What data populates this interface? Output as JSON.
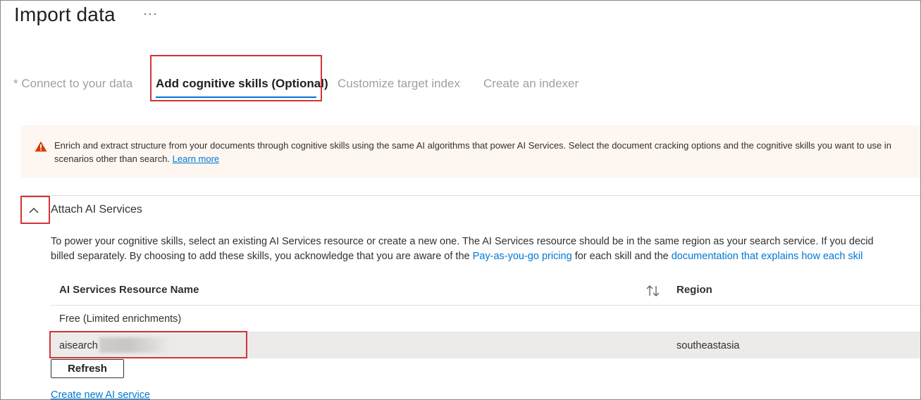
{
  "page": {
    "title": "Import data",
    "more_label": "···"
  },
  "wizard": {
    "tabs": [
      {
        "label": "* Connect to your data",
        "state": "inactive"
      },
      {
        "label": "Add cognitive skills (Optional)",
        "state": "active"
      },
      {
        "label": "Customize target index",
        "state": "inactive"
      },
      {
        "label": "Create an indexer",
        "state": "inactive"
      }
    ]
  },
  "banner": {
    "icon": "warning-icon",
    "text": "Enrich and extract structure from your documents through cognitive skills using the same AI algorithms that power AI Services. Select the document cracking options and the cognitive skills you want to use in scenarios other than search.",
    "learn_more": "Learn more"
  },
  "section": {
    "title": "Attach AI Services",
    "expanded": true,
    "desc_1": "To power your cognitive skills, select an existing AI Services resource or create a new one. The AI Services resource should be in the same region as your search service. If you decid",
    "desc_2": "billed separately. By choosing to add these skills, you acknowledge that you are aware of the",
    "desc_link_1": "Pay-as-you-go pricing",
    "desc_3": "for each skill and the",
    "desc_link_2": "documentation that explains how each skil"
  },
  "table": {
    "columns": {
      "name": "AI Services Resource Name",
      "region": "Region"
    },
    "rows": [
      {
        "name": "Free (Limited enrichments)",
        "region": ""
      },
      {
        "name": "aisearch",
        "region": "southeastasia",
        "selected": true
      }
    ]
  },
  "buttons": {
    "refresh": "Refresh",
    "create_new": "Create new AI service"
  },
  "colors": {
    "accent": "#0078d4",
    "highlight": "#d13438",
    "warning": "#d83b01",
    "banner_bg": "#fdf6f1",
    "selected_row": "#edebe9"
  }
}
